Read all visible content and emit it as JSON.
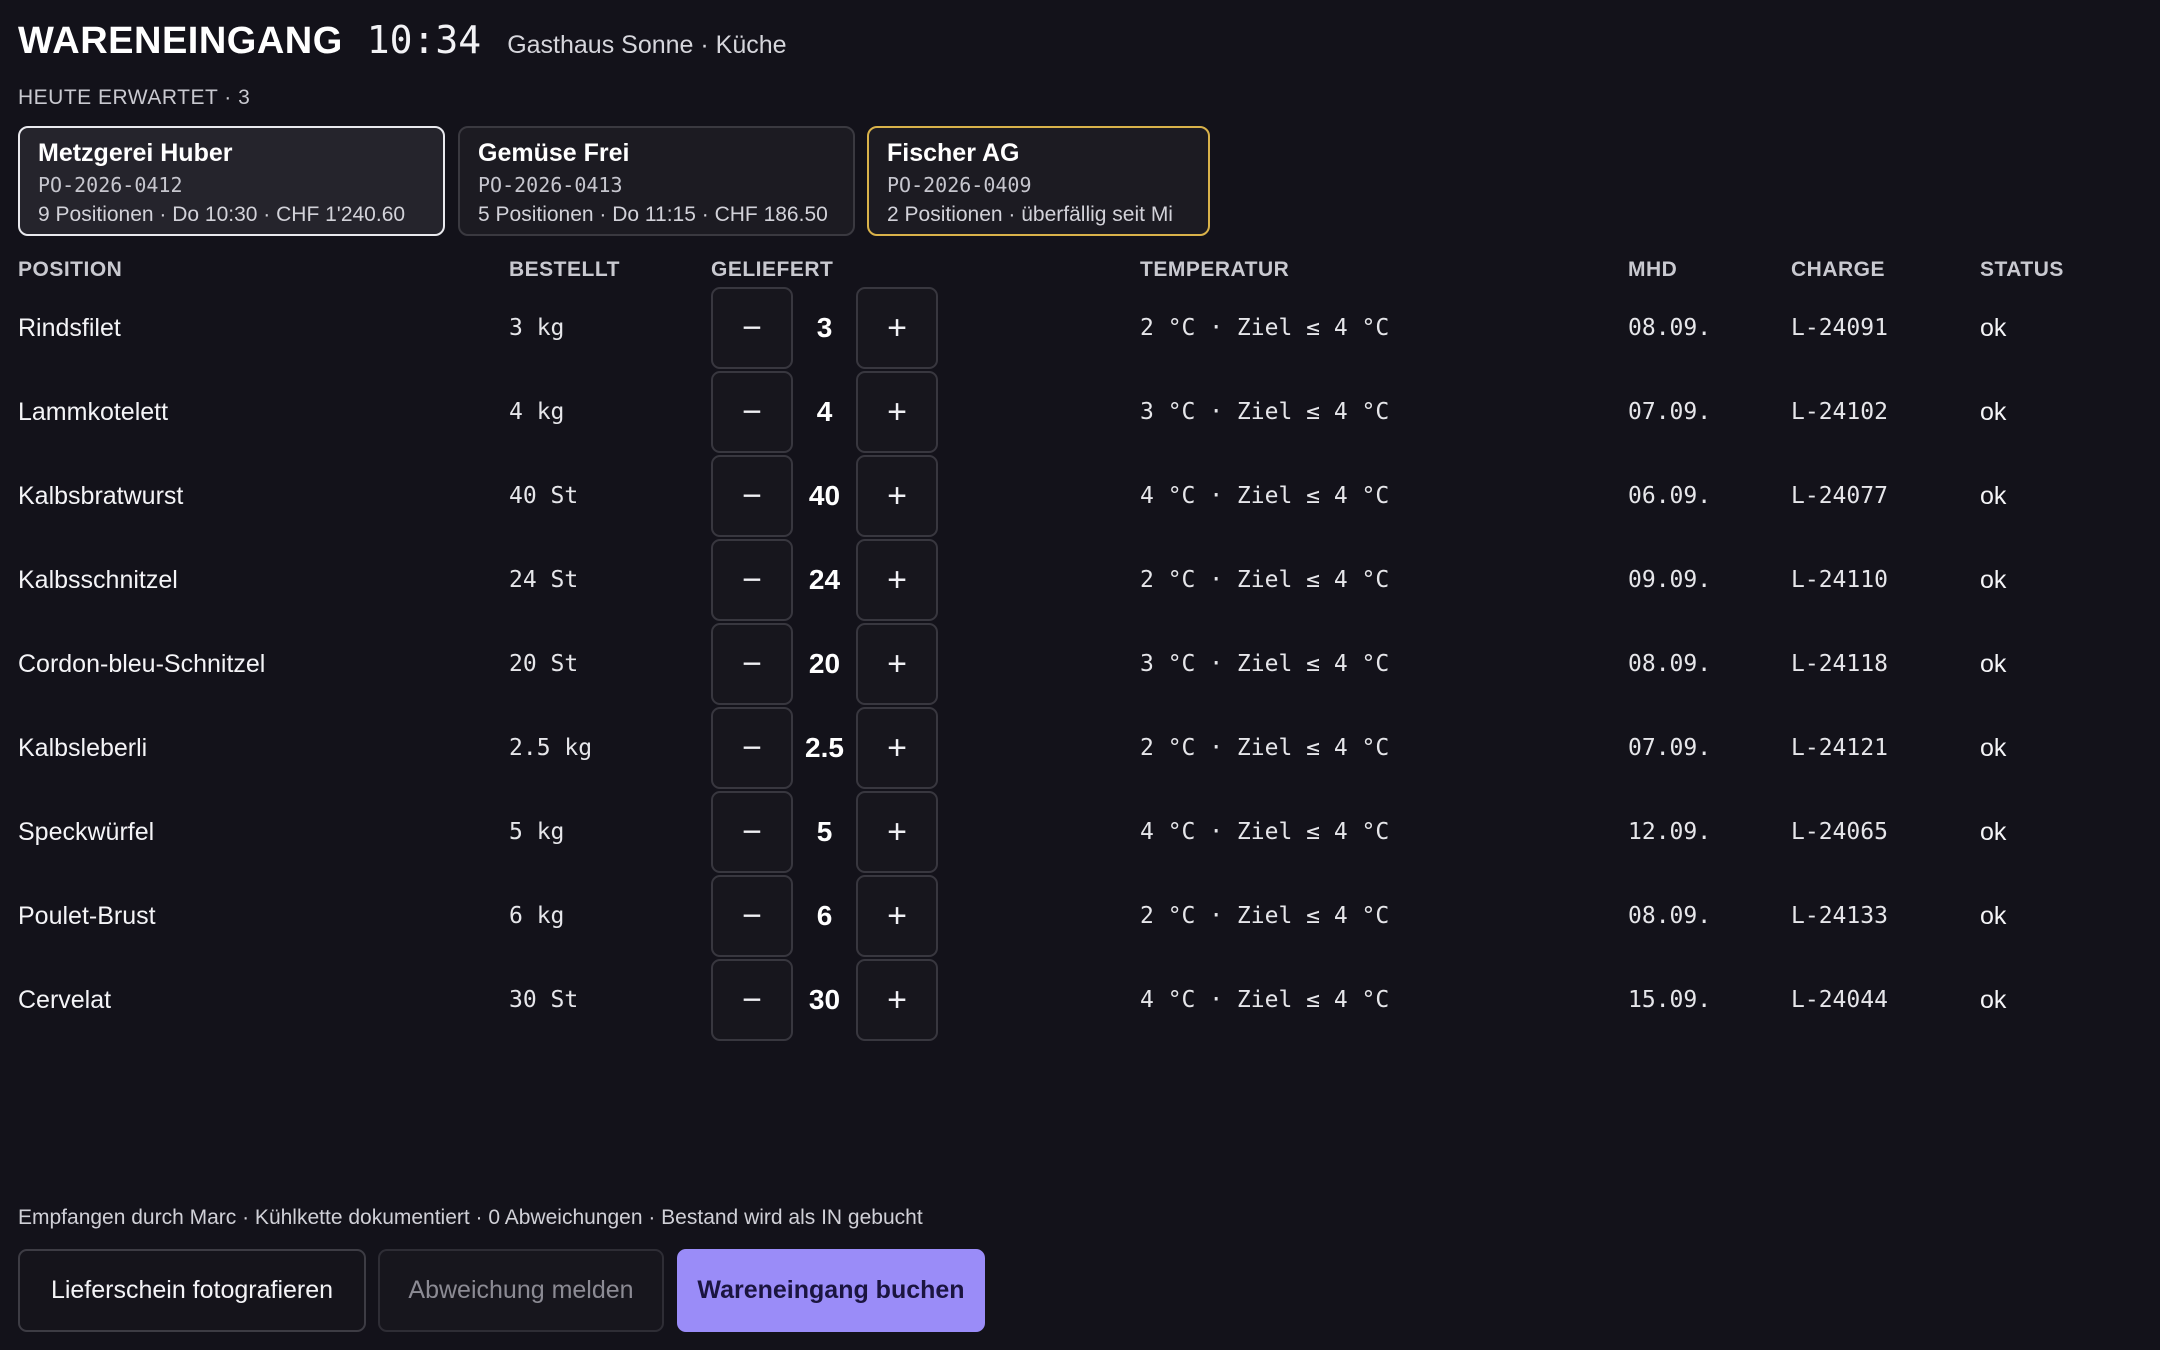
{
  "header": {
    "title": "WARENEINGANG",
    "time": "10:34",
    "location": "Gasthaus Sonne · Küche"
  },
  "expected": {
    "label": "HEUTE ERWARTET · 3"
  },
  "suppliers": [
    {
      "name": "Metzgerei Huber",
      "po": "PO-2026-0412",
      "meta": "9 Positionen · Do 10:30 · CHF 1'240.60",
      "state": "selected"
    },
    {
      "name": "Gemüse Frei",
      "po": "PO-2026-0413",
      "meta": "5 Positionen · Do 11:15 · CHF 186.50",
      "state": "normal"
    },
    {
      "name": "Fischer AG",
      "po": "PO-2026-0409",
      "meta": "2 Positionen · überfällig seit Mi",
      "state": "overdue"
    }
  ],
  "table": {
    "headers": {
      "position": "POSITION",
      "ordered": "BESTELLT",
      "delivered": "GELIEFERT",
      "temperature": "TEMPERATUR",
      "mhd": "MHD",
      "charge": "CHARGE",
      "status": "STATUS"
    },
    "rows": [
      {
        "name": "Rindsfilet",
        "ordered": "3 kg",
        "delivered": "3",
        "temp": "2 °C · Ziel ≤ 4 °C",
        "mhd": "08.09.",
        "charge": "L-24091",
        "status": "ok"
      },
      {
        "name": "Lammkotelett",
        "ordered": "4 kg",
        "delivered": "4",
        "temp": "3 °C · Ziel ≤ 4 °C",
        "mhd": "07.09.",
        "charge": "L-24102",
        "status": "ok"
      },
      {
        "name": "Kalbsbratwurst",
        "ordered": "40 St",
        "delivered": "40",
        "temp": "4 °C · Ziel ≤ 4 °C",
        "mhd": "06.09.",
        "charge": "L-24077",
        "status": "ok"
      },
      {
        "name": "Kalbsschnitzel",
        "ordered": "24 St",
        "delivered": "24",
        "temp": "2 °C · Ziel ≤ 4 °C",
        "mhd": "09.09.",
        "charge": "L-24110",
        "status": "ok"
      },
      {
        "name": "Cordon-bleu-Schnitzel",
        "ordered": "20 St",
        "delivered": "20",
        "temp": "3 °C · Ziel ≤ 4 °C",
        "mhd": "08.09.",
        "charge": "L-24118",
        "status": "ok"
      },
      {
        "name": "Kalbsleberli",
        "ordered": "2.5 kg",
        "delivered": "2.5",
        "temp": "2 °C · Ziel ≤ 4 °C",
        "mhd": "07.09.",
        "charge": "L-24121",
        "status": "ok"
      },
      {
        "name": "Speckwürfel",
        "ordered": "5 kg",
        "delivered": "5",
        "temp": "4 °C · Ziel ≤ 4 °C",
        "mhd": "12.09.",
        "charge": "L-24065",
        "status": "ok"
      },
      {
        "name": "Poulet-Brust",
        "ordered": "6 kg",
        "delivered": "6",
        "temp": "2 °C · Ziel ≤ 4 °C",
        "mhd": "08.09.",
        "charge": "L-24133",
        "status": "ok"
      },
      {
        "name": "Cervelat",
        "ordered": "30 St",
        "delivered": "30",
        "temp": "4 °C · Ziel ≤ 4 °C",
        "mhd": "15.09.",
        "charge": "L-24044",
        "status": "ok"
      }
    ]
  },
  "stepper": {
    "minus_icon": "−",
    "plus_icon": "+"
  },
  "footer": {
    "note": "Empfangen durch Marc · Kühlkette dokumentiert · 0 Abweichungen · Bestand wird als IN gebucht",
    "photo_label": "Lieferschein fotografieren",
    "deviation_label": "Abweichung melden",
    "book_label": "Wareneingang buchen"
  },
  "colors": {
    "background": "#13121a",
    "accent": "#9a8cf8",
    "overdue_border": "#d9b24a",
    "selected_border": "#e9e9ee"
  }
}
